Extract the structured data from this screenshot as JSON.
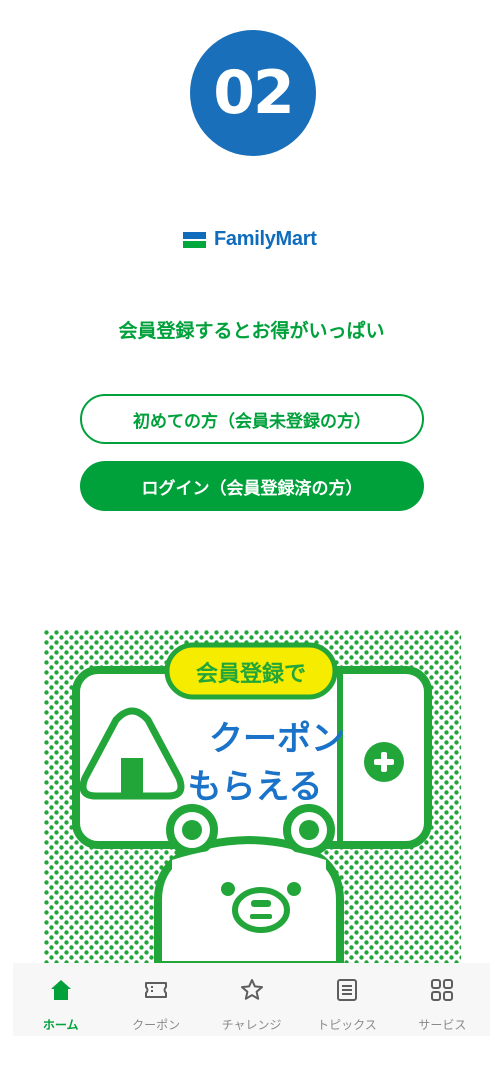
{
  "step": {
    "number": "02"
  },
  "brand": {
    "name": "FamilyMart",
    "colors": {
      "blue": "#0f6cbd",
      "green": "#00a73c"
    }
  },
  "tagline": "会員登録するとお得がいっぱい",
  "buttons": {
    "first_time": "初めての方（会員未登録の方）",
    "login": "ログイン（会員登録済の方）"
  },
  "banner": {
    "badge": "会員登録で",
    "line1": "クーポン",
    "line2": "もらえる",
    "colors": {
      "green": "#22a63a",
      "yellow": "#f5ec00",
      "blue": "#1a73c8"
    }
  },
  "tabbar": {
    "active": "home",
    "items": [
      {
        "id": "home",
        "label": "ホーム",
        "icon": "home-icon"
      },
      {
        "id": "coupon",
        "label": "クーポン",
        "icon": "ticket-icon"
      },
      {
        "id": "challenge",
        "label": "チャレンジ",
        "icon": "star-icon"
      },
      {
        "id": "topics",
        "label": "トピックス",
        "icon": "document-icon"
      },
      {
        "id": "service",
        "label": "サービス",
        "icon": "grid-icon"
      }
    ]
  }
}
